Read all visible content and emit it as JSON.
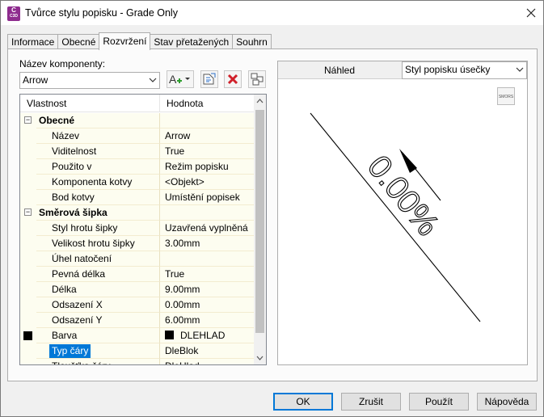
{
  "window": {
    "title": "Tvůrce stylu popisku - Grade Only",
    "icon_text": "C",
    "icon_version": "C3D"
  },
  "tabs": [
    {
      "label": "Informace",
      "active": false
    },
    {
      "label": "Obecné",
      "active": false
    },
    {
      "label": "Rozvržení",
      "active": true
    },
    {
      "label": "Stav přetažených",
      "active": false
    },
    {
      "label": "Souhrn",
      "active": false
    }
  ],
  "component": {
    "label": "Název komponenty:",
    "selected": "Arrow"
  },
  "toolbar": {
    "add_icon": "add-component-icon",
    "copy_icon": "copy-component-icon",
    "delete_icon": "delete-component-icon",
    "order_icon": "component-draw-order-icon"
  },
  "grid": {
    "col_property": "Vlastnost",
    "col_value": "Hodnota",
    "rows": [
      {
        "type": "cat",
        "prop": "Obecné",
        "val": ""
      },
      {
        "type": "row",
        "prop": "Název",
        "val": "Arrow"
      },
      {
        "type": "row",
        "prop": "Viditelnost",
        "val": "True"
      },
      {
        "type": "row",
        "prop": "Použito v",
        "val": "Režim popisku"
      },
      {
        "type": "row",
        "prop": "Komponenta kotvy",
        "val": "<Objekt>"
      },
      {
        "type": "row",
        "prop": "Bod kotvy",
        "val": "Umístění popisek"
      },
      {
        "type": "cat",
        "prop": "Směrová šipka",
        "val": ""
      },
      {
        "type": "row",
        "prop": "Styl hrotu šipky",
        "val": "Uzavřená vyplněná"
      },
      {
        "type": "row",
        "prop": "Velikost hrotu šipky",
        "val": "3.00mm"
      },
      {
        "type": "row",
        "prop": "Úhel natočení",
        "val": ""
      },
      {
        "type": "row",
        "prop": "Pevná délka",
        "val": "True"
      },
      {
        "type": "row",
        "prop": "Délka",
        "val": "9.00mm"
      },
      {
        "type": "row",
        "prop": "Odsazení X",
        "val": "0.00mm"
      },
      {
        "type": "row",
        "prop": "Odsazení Y",
        "val": "6.00mm"
      },
      {
        "type": "color",
        "prop": "Barva",
        "val": "DLEHLAD"
      },
      {
        "type": "sel",
        "prop": "Typ čáry",
        "val": "DleBlok"
      },
      {
        "type": "row",
        "prop": "Tloušťka čáry",
        "val": "DleHlad"
      }
    ]
  },
  "preview": {
    "label": "Náhled",
    "style_selected": "Styl popisku úsečky",
    "label_text": "0.00%",
    "smart_button_text": "SMORS"
  },
  "buttons": {
    "ok": "OK",
    "cancel": "Zrušit",
    "apply": "Použít",
    "help": "Nápověda"
  },
  "colors": {
    "selection": "#0078d7",
    "property_bg": "#fdfdf0",
    "swatch": "#000000"
  }
}
